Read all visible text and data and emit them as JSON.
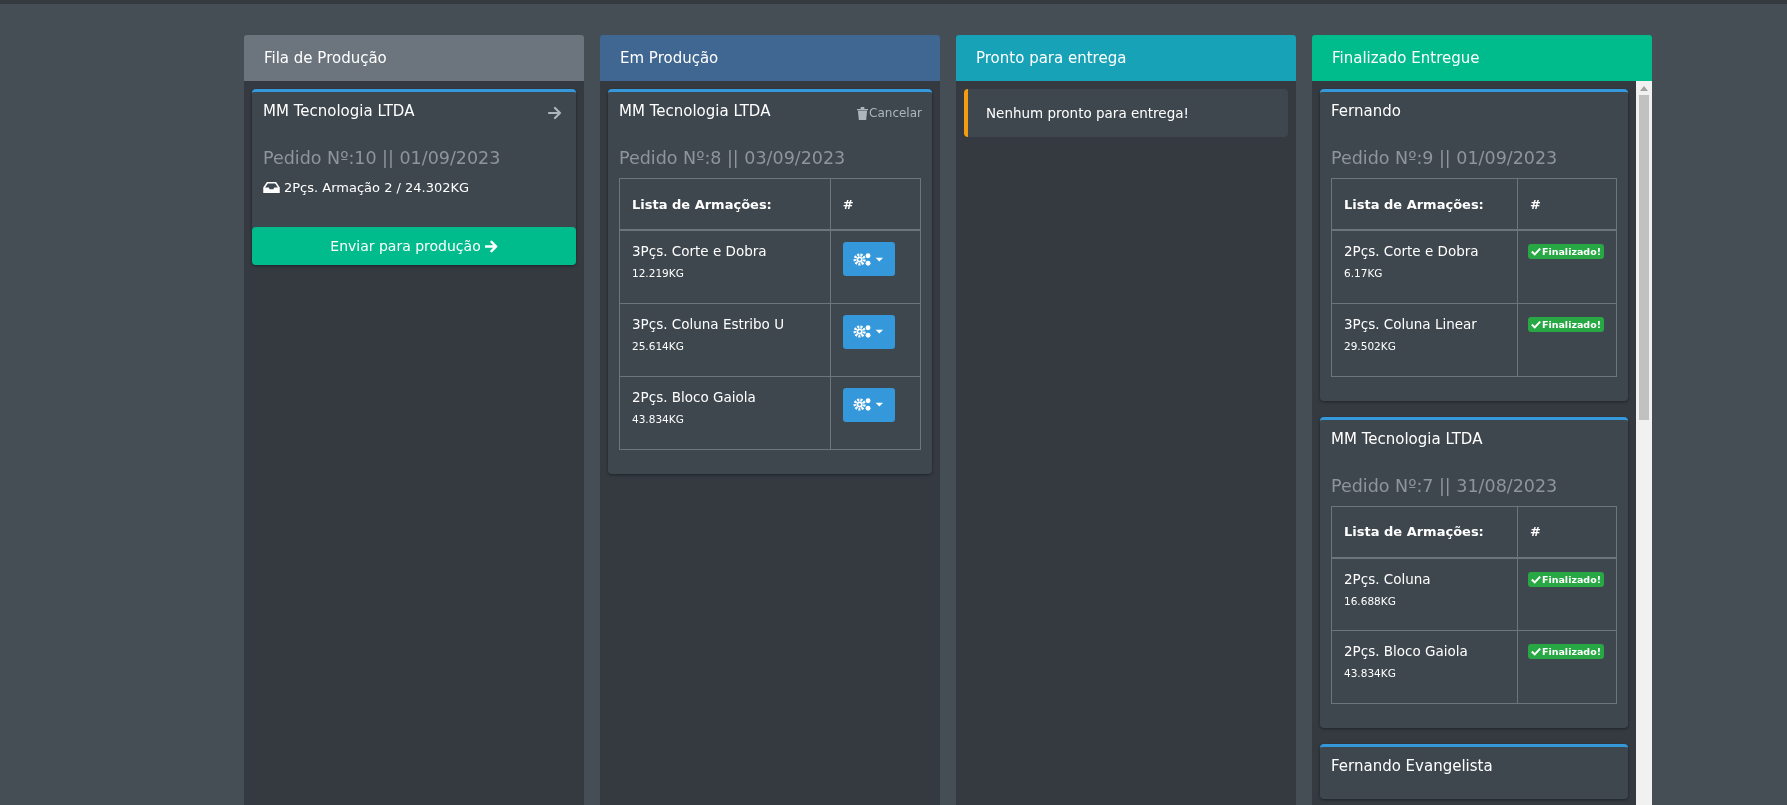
{
  "columns": [
    {
      "title": "Fila de Produção",
      "color": "#6c757d",
      "scrollable": false,
      "cards": [
        {
          "kind": "queue",
          "client": "MM Tecnologia LTDA",
          "order": "Pedido Nº:10 || 01/09/2023",
          "item": "2Pçs. Armação 2 / 24.302KG",
          "button": "Enviar para produção"
        }
      ]
    },
    {
      "title": "Em Produção",
      "color": "#3f6791",
      "scrollable": false,
      "cards": [
        {
          "kind": "production",
          "client": "MM Tecnologia LTDA",
          "cancel": "Cancelar",
          "order": "Pedido Nº:8 || 03/09/2023",
          "table": {
            "columns": [
              "Lista de Armações:",
              "#"
            ],
            "rows": [
              {
                "kind": "action",
                "name": "3Pçs. Corte e Dobra",
                "weight": "12.219KG"
              },
              {
                "kind": "action",
                "name": "3Pçs. Coluna Estribo U",
                "weight": "25.614KG"
              },
              {
                "kind": "action",
                "name": "2Pçs. Bloco Gaiola",
                "weight": "43.834KG"
              }
            ]
          }
        }
      ]
    },
    {
      "title": "Pronto para entrega",
      "color": "#17a2b8",
      "scrollable": false,
      "cards": [
        {
          "kind": "empty",
          "message": "Nenhum pronto para entrega!"
        }
      ]
    },
    {
      "title": "Finalizado Entregue",
      "color": "#00bc8c",
      "scrollable": true,
      "cards": [
        {
          "kind": "done",
          "client": "Fernando",
          "order": "Pedido Nº:9 || 01/09/2023",
          "table": {
            "columns": [
              "Lista de Armações:",
              "#"
            ],
            "rows": [
              {
                "kind": "done",
                "name": "2Pçs. Corte e Dobra",
                "weight": "6.17KG",
                "badge": "Finalizado!"
              },
              {
                "kind": "done",
                "name": "3Pçs. Coluna Linear",
                "weight": "29.502KG",
                "badge": "Finalizado!"
              }
            ]
          }
        },
        {
          "kind": "done",
          "client": "MM Tecnologia LTDA",
          "order": "Pedido Nº:7 || 31/08/2023",
          "table": {
            "columns": [
              "Lista de Armações:",
              "#"
            ],
            "rows": [
              {
                "kind": "done",
                "name": "2Pçs. Coluna",
                "weight": "16.688KG",
                "badge": "Finalizado!"
              },
              {
                "kind": "done",
                "name": "2Pçs. Bloco Gaiola",
                "weight": "43.834KG",
                "badge": "Finalizado!"
              }
            ]
          }
        },
        {
          "kind": "done",
          "client": "Fernando Evangelista"
        }
      ]
    }
  ]
}
